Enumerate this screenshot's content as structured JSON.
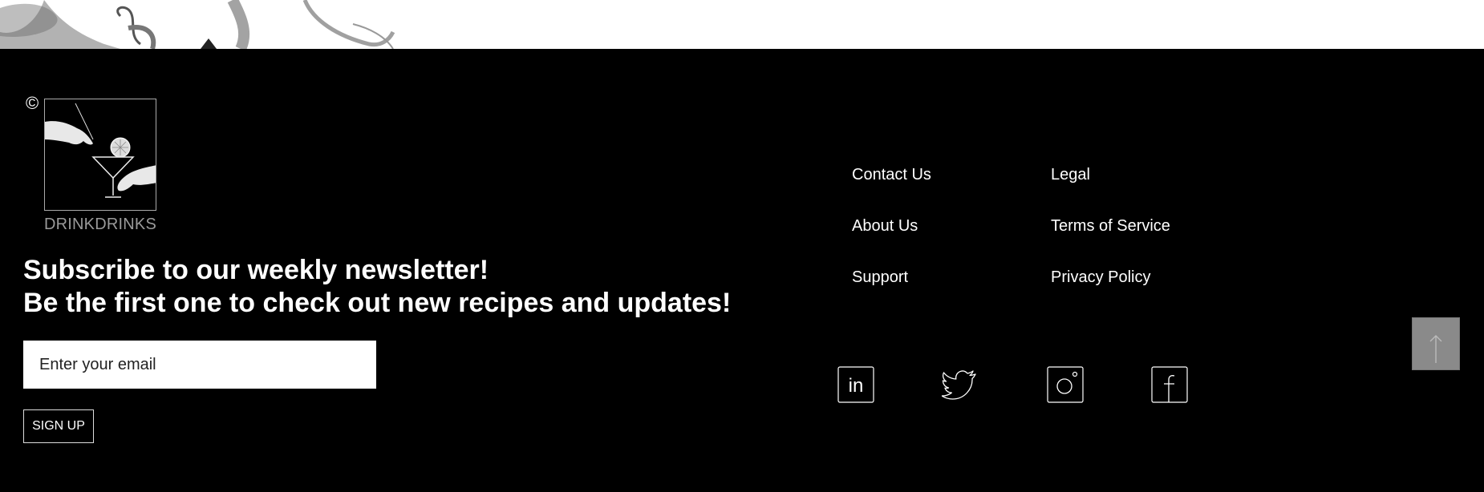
{
  "brand": {
    "copyright_symbol": "©",
    "name": "DRINKDRINKS"
  },
  "newsletter": {
    "title_line1": "Subscribe to our weekly newsletter!",
    "title_line2": "Be the first one to check out new recipes and updates!",
    "email_placeholder": "Enter your email",
    "signup_label": "SIGN UP"
  },
  "nav": {
    "col1": [
      "Contact Us",
      "About Us",
      "Support"
    ],
    "col2": [
      "Legal",
      "Terms of Service",
      "Privacy Policy"
    ]
  },
  "social": [
    {
      "name": "linkedin-icon",
      "glyph": "in"
    },
    {
      "name": "twitter-icon",
      "glyph": ""
    },
    {
      "name": "instagram-icon",
      "glyph": ""
    },
    {
      "name": "facebook-icon",
      "glyph": "f"
    }
  ],
  "back_to_top": {
    "icon": "arrow-up-icon"
  },
  "colors": {
    "background": "#000000",
    "text": "#ffffff",
    "brand_text": "#9a9a9a",
    "back_to_top_bg": "#8a8a8a"
  }
}
